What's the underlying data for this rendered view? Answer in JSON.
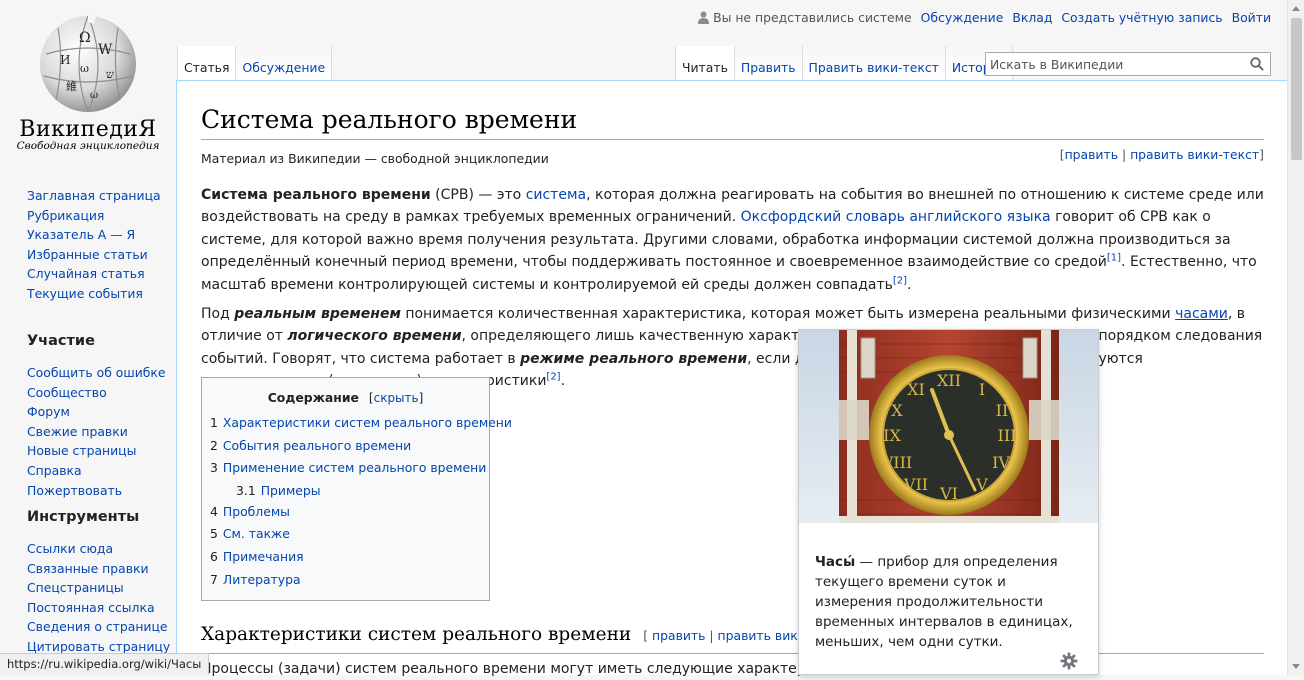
{
  "logo": {
    "wordmark": "ВикипедиЯ",
    "tagline": "Свободная энциклопедия"
  },
  "personal": {
    "anon": "Вы не представились системе",
    "links": [
      "Обсуждение",
      "Вклад",
      "Создать учётную запись",
      "Войти"
    ]
  },
  "tabs_left": [
    {
      "label": "Статья",
      "selected": true
    },
    {
      "label": "Обсуждение",
      "selected": false
    }
  ],
  "tabs_right": [
    {
      "label": "Читать",
      "selected": true
    },
    {
      "label": "Править",
      "selected": false
    },
    {
      "label": "Править вики-текст",
      "selected": false
    },
    {
      "label": "История",
      "selected": false
    }
  ],
  "search": {
    "placeholder": "Искать в Википедии",
    "value": ""
  },
  "sidebar": {
    "nav": [
      "Заглавная страница",
      "Рубрикация",
      "Указатель А — Я",
      "Избранные статьи",
      "Случайная статья",
      "Текущие события"
    ],
    "participation_title": "Участие",
    "participation": [
      "Сообщить об ошибке",
      "Сообщество",
      "Форум",
      "Свежие правки",
      "Новые страницы",
      "Справка",
      "Пожертвовать"
    ],
    "tools_title": "Инструменты",
    "tools": [
      "Ссылки сюда",
      "Связанные правки",
      "Спецстраницы",
      "Постоянная ссылка",
      "Сведения о странице",
      "Цитировать страницу"
    ]
  },
  "article": {
    "title": "Система реального времени",
    "site_sub": "Материал из Википедии — свободной энциклопедии",
    "edit_links": {
      "open": "[",
      "edit": "править",
      "sep": " | ",
      "edit_source": "править вики-текст",
      "close": "]"
    },
    "p1": {
      "b1": "Система реального времени",
      "t1": " (СРВ) — это ",
      "l1": "система",
      "t2": ", которая должна реагировать на события во внешней по отношению к системе среде или воздействовать на среду в рамках требуемых временных ограничений. ",
      "l2": "Оксфордский словарь английского языка",
      "t3": " говорит об СРВ как о системе, для которой важно время получения результата. Другими словами, обработка информации системой должна производиться за определённый конечный период времени, чтобы поддерживать постоянное и своевременное взаимодействие со средой",
      "ref1": "[1]",
      "t4": ". Естественно, что масштаб времени контролирующей системы и контролируемой ей среды должен совпадать",
      "ref2": "[2]",
      "t5": "."
    },
    "p2": {
      "t1": "Под ",
      "bi1": "реальным временем",
      "t2": " понимается количественная характеристика, которая может быть измерена реальными физическими ",
      "l1": "часами",
      "t3": ", в отличие от ",
      "bi2": "логического времени",
      "t4": ", определяющего лишь качественную характеристику, выражаемую относительным порядком следования событий. Говорят, что система работает в ",
      "bi3": "режиме реального времени",
      "t5": ", если для описания работы этой системы требуются количественные (временные) характеристики",
      "ref": "[2]",
      "t6": "."
    },
    "toc": {
      "title": "Содержание",
      "toggle": "скрыть",
      "items": [
        {
          "num": "1",
          "label": "Характеристики систем реального времени",
          "sub": false
        },
        {
          "num": "2",
          "label": "События реального времени",
          "sub": false
        },
        {
          "num": "3",
          "label": "Применение систем реального времени",
          "sub": false
        },
        {
          "num": "3.1",
          "label": "Примеры",
          "sub": true
        },
        {
          "num": "4",
          "label": "Проблемы",
          "sub": false
        },
        {
          "num": "5",
          "label": "См. также",
          "sub": false
        },
        {
          "num": "6",
          "label": "Примечания",
          "sub": false
        },
        {
          "num": "7",
          "label": "Литература",
          "sub": false
        }
      ]
    },
    "h2": "Характеристики систем реального времени",
    "h2_edit": {
      "open": "[ ",
      "edit": "править",
      "sep": " | ",
      "edit_source": "править вики-текст",
      "close": " ]"
    },
    "p3": "Процессы (задачи) систем реального времени могут иметь следующие характеристики и"
  },
  "popup": {
    "bold": "Часы́",
    "text": " — прибор для определения текущего времени суток и измерения продолжительности временных интервалов в единицах, меньших, чем одни сутки."
  },
  "statusbar": "https://ru.wikipedia.org/wiki/Часы"
}
